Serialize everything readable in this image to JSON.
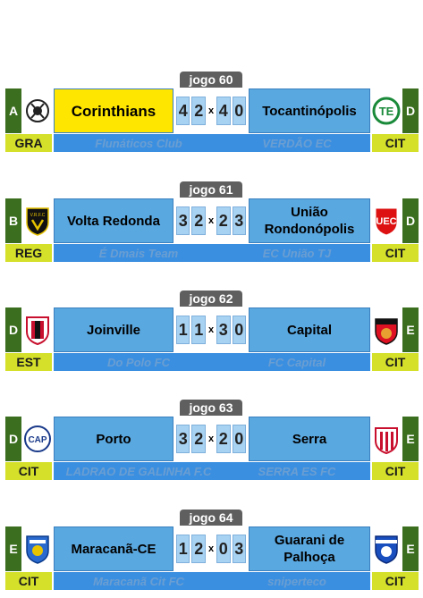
{
  "matches": [
    {
      "jogo": "jogo 60",
      "home": {
        "group": "A",
        "abbr": "GRA",
        "team": "Corinthians",
        "coach": "Flunáticos Club",
        "score": [
          "4",
          "2"
        ],
        "logo": "corinthians-logo"
      },
      "away": {
        "group": "D",
        "abbr": "CIT",
        "team": "Tocantinópolis",
        "coach": "VERDÃO EC",
        "score": [
          "4",
          "0"
        ],
        "logo": "tocantinopolis-logo"
      }
    },
    {
      "jogo": "jogo 61",
      "home": {
        "group": "B",
        "abbr": "REG",
        "team": "Volta Redonda",
        "coach": "É Dmais Team",
        "score": [
          "3",
          "2"
        ],
        "logo": "volta-redonda-logo"
      },
      "away": {
        "group": "D",
        "abbr": "CIT",
        "team": "União Rondonópolis",
        "coach": "EC União TJ",
        "score": [
          "2",
          "3"
        ],
        "logo": "uniao-rondonopolis-logo"
      }
    },
    {
      "jogo": "jogo 62",
      "home": {
        "group": "D",
        "abbr": "EST",
        "team": "Joinville",
        "coach": "Do Polo FC",
        "score": [
          "1",
          "1"
        ],
        "logo": "joinville-logo"
      },
      "away": {
        "group": "E",
        "abbr": "CIT",
        "team": "Capital",
        "coach": "FC Capital",
        "score": [
          "3",
          "0"
        ],
        "logo": "capital-logo"
      }
    },
    {
      "jogo": "jogo 63",
      "home": {
        "group": "D",
        "abbr": "CIT",
        "team": "Porto",
        "coach": "LADRAO DE GALINHA F.C",
        "score": [
          "3",
          "2"
        ],
        "logo": "porto-logo"
      },
      "away": {
        "group": "E",
        "abbr": "CIT",
        "team": "Serra",
        "coach": "SERRA ES FC",
        "score": [
          "2",
          "0"
        ],
        "logo": "serra-logo"
      }
    },
    {
      "jogo": "jogo 64",
      "home": {
        "group": "E",
        "abbr": "CIT",
        "team": "Maracanã-CE",
        "coach": "Maracanã Cit FC",
        "score": [
          "1",
          "2"
        ],
        "logo": "maracana-logo"
      },
      "away": {
        "group": "E",
        "abbr": "CIT",
        "team": "Guarani de Palhoça",
        "coach": "sniperteco",
        "score": [
          "0",
          "3"
        ],
        "logo": "guarani-palhoca-logo"
      }
    }
  ]
}
